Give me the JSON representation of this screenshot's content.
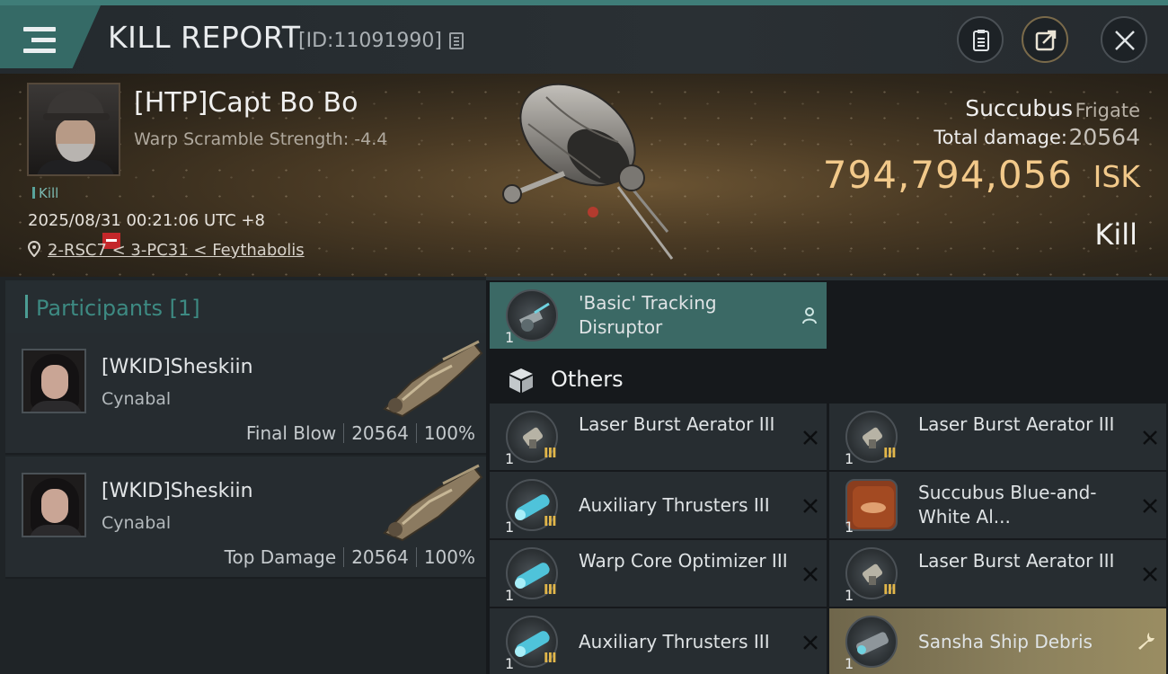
{
  "header": {
    "title": "KILL REPORT",
    "report_id": "[ID:11091990]"
  },
  "victim": {
    "name": "[HTP]Capt Bo Bo",
    "warp_scramble": "Warp Scramble Strength: -4.4",
    "kill_tag": "Kill",
    "time": "2025/08/31 00:21:06 UTC +8",
    "location": "2-RSC7 < 3-PC31 < Feythabolis",
    "ship_name": "Succubus",
    "ship_class": "Frigate",
    "total_damage_label": "Total damage:",
    "total_damage": "20564",
    "isk_value": "794,794,056",
    "isk_unit": "ISK",
    "result": "Kill"
  },
  "participants": {
    "title": "Participants",
    "count": "[1]",
    "rows": [
      {
        "name": "[WKID]Sheskiin",
        "ship": "Cynabal",
        "role": "Final Blow",
        "damage": "20564",
        "percent": "100%"
      },
      {
        "name": "[WKID]Sheskiin",
        "ship": "Cynabal",
        "role": "Top Damage",
        "damage": "20564",
        "percent": "100%"
      }
    ]
  },
  "items": {
    "highlighted": {
      "name": "'Basic' Tracking Disruptor",
      "qty": "1"
    },
    "others_title": "Others",
    "list": [
      {
        "name": "Laser Burst Aerator III",
        "qty": "1",
        "tier": "III"
      },
      {
        "name": "Laser Burst Aerator III",
        "qty": "1",
        "tier": "III"
      },
      {
        "name": "Auxiliary Thrusters III",
        "qty": "1",
        "tier": "III"
      },
      {
        "name": "Succubus Blue-and-White Al...",
        "qty": "1",
        "tier": ""
      },
      {
        "name": "Warp Core Optimizer III",
        "qty": "1",
        "tier": "III"
      },
      {
        "name": "Laser Burst Aerator III",
        "qty": "1",
        "tier": "III"
      },
      {
        "name": "Auxiliary Thrusters III",
        "qty": "1",
        "tier": "III"
      },
      {
        "name": "Sansha Ship Debris",
        "qty": "1",
        "tier": ""
      }
    ]
  },
  "colors": {
    "accent_teal": "#3f7d78",
    "isk_gold": "#f2c98a",
    "tier_gold": "#e1b64a",
    "debris_highlight": "#8c815d"
  }
}
